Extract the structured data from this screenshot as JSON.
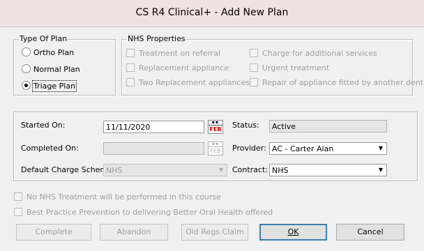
{
  "window": {
    "title": "CS R4 Clinical+ - Add New Plan"
  },
  "type_of_plan": {
    "legend": "Type Of Plan",
    "options": [
      {
        "label": "Ortho Plan",
        "checked": false
      },
      {
        "label": "Normal Plan",
        "checked": false
      },
      {
        "label": "Triage Plan",
        "checked": true
      }
    ]
  },
  "nhs_properties": {
    "legend": "NHS Properties",
    "items": [
      {
        "label": "Treatment on referral",
        "checked": false,
        "enabled": false
      },
      {
        "label": "Charge for additional services",
        "checked": false,
        "enabled": false
      },
      {
        "label": "Replacement appliance",
        "checked": false,
        "enabled": false
      },
      {
        "label": "Urgent treatment",
        "checked": false,
        "enabled": false
      },
      {
        "label": "Two Replacement appliances",
        "checked": false,
        "enabled": false
      },
      {
        "label": "Repair of appliance fitted by another dentist",
        "checked": false,
        "enabled": false
      }
    ]
  },
  "details": {
    "started_on": {
      "label": "Started On:",
      "value": "11/11/2020"
    },
    "completed_on": {
      "label": "Completed On:",
      "value": ""
    },
    "default_charge_scheme": {
      "label": "Default Charge Scheme:",
      "value": "NHS"
    },
    "status": {
      "label": "Status:",
      "value": "Active"
    },
    "provider": {
      "label": "Provider:",
      "value": "AC - Carter Alan"
    },
    "contract": {
      "label": "Contract:",
      "value": "NHS"
    },
    "calendar_icon_text": "FEB"
  },
  "options": {
    "no_nhs": {
      "label": "No NHS Treatment will be performed in this course",
      "checked": false,
      "enabled": false
    },
    "best_practice": {
      "label": "Best Practice Prevention to delivering Better Oral Health offered",
      "checked": false,
      "enabled": false
    }
  },
  "buttons": {
    "complete": "Complete",
    "abandon": "Abandon",
    "old_regs_claim": "Old Regs Claim",
    "ok": "OK",
    "cancel": "Cancel"
  }
}
